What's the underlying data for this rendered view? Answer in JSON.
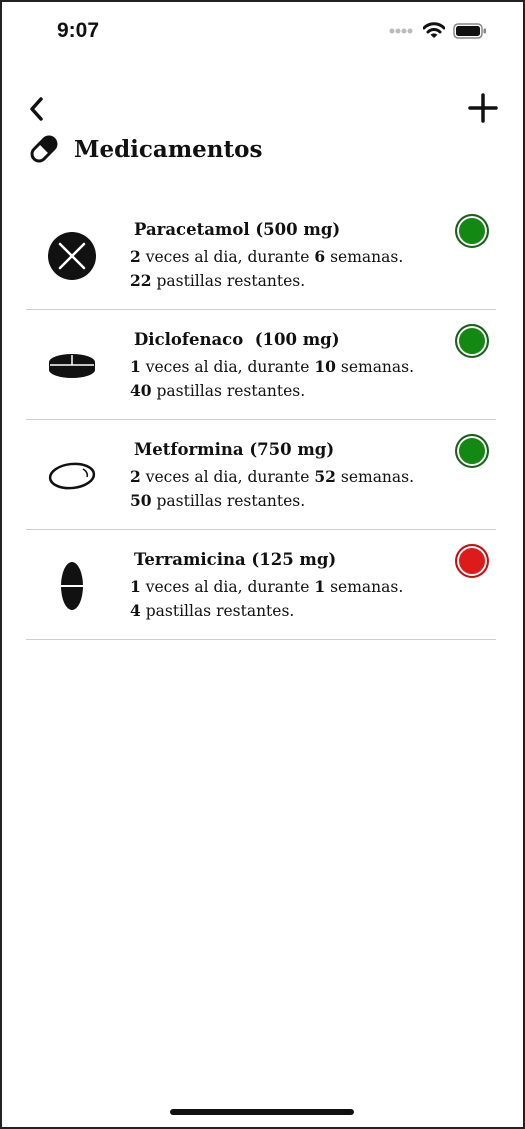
{
  "status_bar": {
    "time": "9:07"
  },
  "header": {
    "title": "Medicamentos"
  },
  "colors": {
    "active": "#138813",
    "inactive": "#dd1b1b"
  },
  "medications": [
    {
      "name": "Paracetamol (500 mg)",
      "times": "2",
      "mid": " veces al dia, durante ",
      "weeks": "6",
      "weeks_suffix": " semanas.",
      "pills": "22",
      "pills_suffix": " pastillas restantes.",
      "icon": "pill-round-cross-icon",
      "status": "active"
    },
    {
      "name": "Diclofenaco  (100 mg)",
      "times": "1",
      "mid": " veces al dia, durante ",
      "weeks": "10",
      "weeks_suffix": " semanas.",
      "pills": "40",
      "pills_suffix": " pastillas restantes.",
      "icon": "pill-disc-icon",
      "status": "active"
    },
    {
      "name": "Metformina (750 mg)",
      "times": "2",
      "mid": " veces al dia, durante ",
      "weeks": "52",
      "weeks_suffix": " semanas.",
      "pills": "50",
      "pills_suffix": " pastillas restantes.",
      "icon": "pill-oval-icon",
      "status": "active"
    },
    {
      "name": "Terramicina (125 mg)",
      "times": "1",
      "mid": " veces al dia, durante ",
      "weeks": "1",
      "weeks_suffix": " semanas.",
      "pills": "4",
      "pills_suffix": " pastillas restantes.",
      "icon": "pill-capsule-icon",
      "status": "inactive"
    }
  ]
}
